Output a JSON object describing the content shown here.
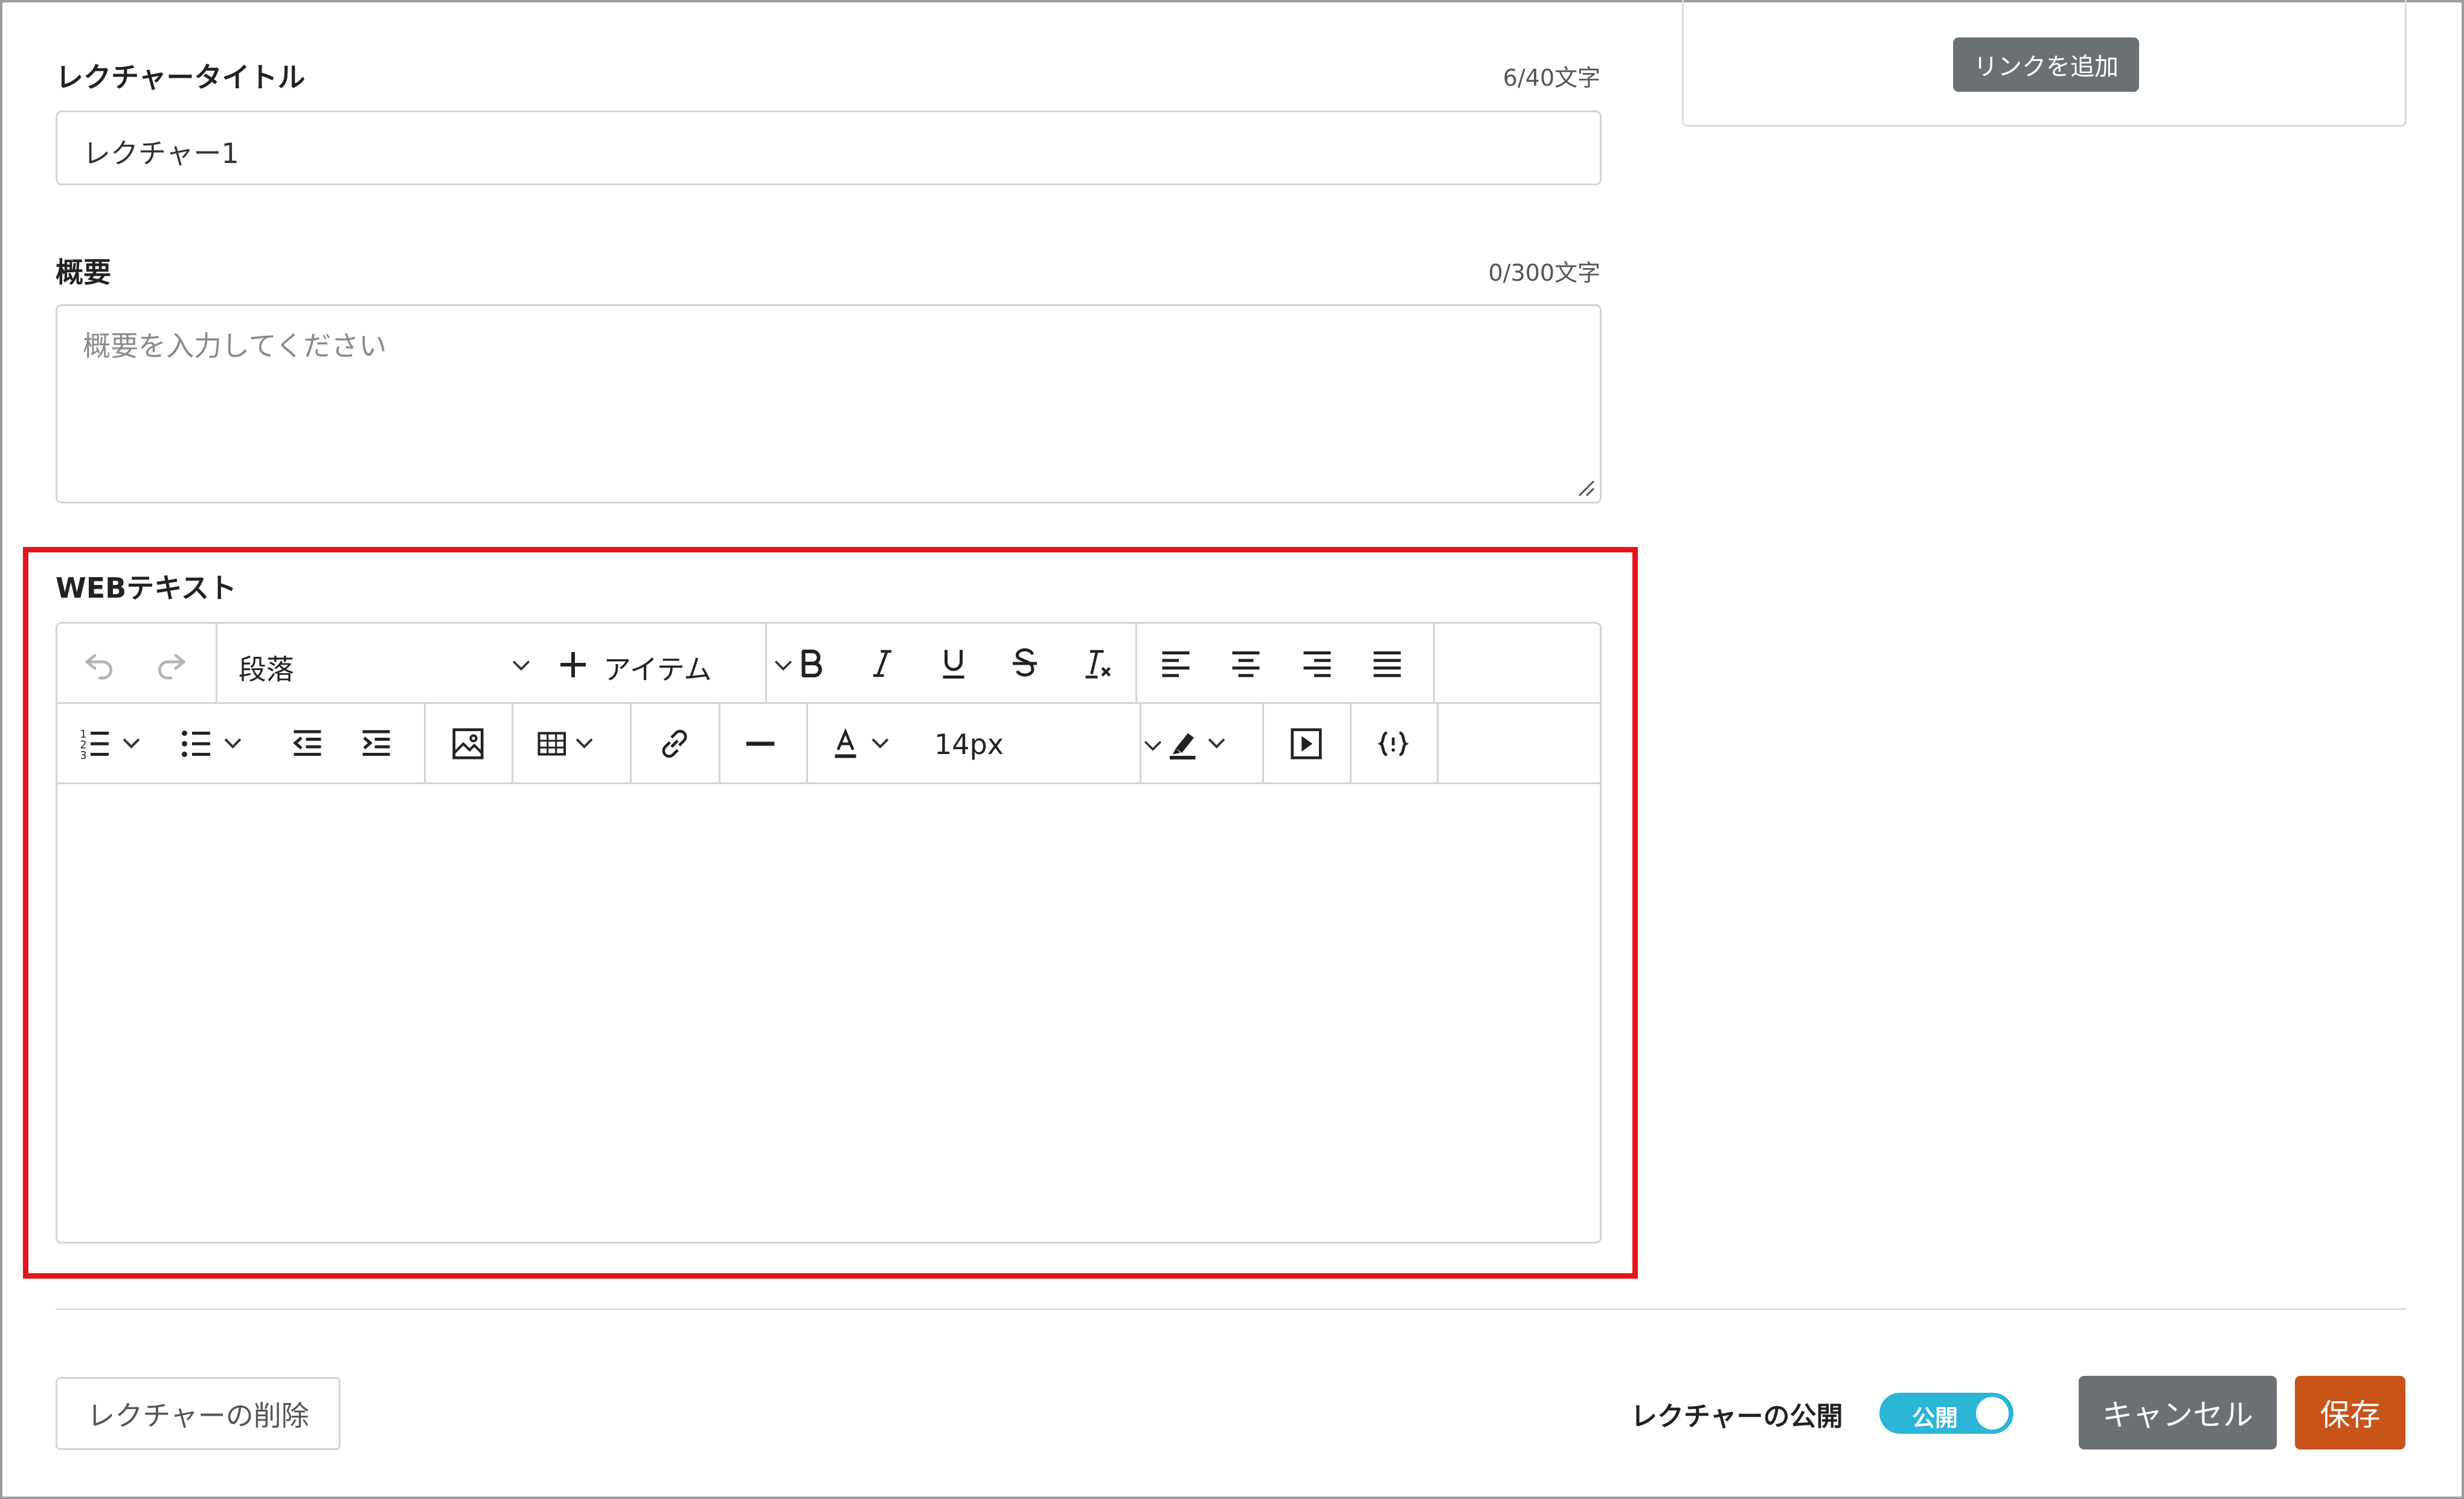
{
  "lecture_title": {
    "label": "レクチャータイトル",
    "counter": "6/40文字",
    "value": "レクチャー1"
  },
  "summary": {
    "label": "概要",
    "counter": "0/300文字",
    "placeholder": "概要を入力してください"
  },
  "links_panel": {
    "add_link_label": "リンクを追加"
  },
  "web_text": {
    "label": "WEBテキスト",
    "toolbar": {
      "block_format": "段落",
      "insert_item": "アイテム",
      "font_size": "14px"
    }
  },
  "footer": {
    "delete_label": "レクチャーの削除",
    "publish_label": "レクチャーの公開",
    "publish_toggle_label": "公開",
    "publish_toggle_on": true,
    "cancel_label": "キャンセル",
    "save_label": "保存"
  },
  "colors": {
    "highlight_border": "#e8141b",
    "save_button": "#c9541a",
    "cancel_button": "#6b7075",
    "toggle_on": "#2bb5d6"
  },
  "icons": [
    "undo-icon",
    "redo-icon",
    "chevron-down-icon",
    "plus-icon",
    "bold-icon",
    "italic-icon",
    "underline-icon",
    "strikethrough-icon",
    "clear-format-icon",
    "align-left-icon",
    "align-center-icon",
    "align-right-icon",
    "align-justify-icon",
    "numbered-list-icon",
    "bulleted-list-icon",
    "outdent-icon",
    "indent-icon",
    "image-icon",
    "table-icon",
    "link-icon",
    "horizontal-line-icon",
    "font-color-icon",
    "highlight-icon",
    "media-icon",
    "source-code-icon",
    "resize-handle-icon"
  ]
}
